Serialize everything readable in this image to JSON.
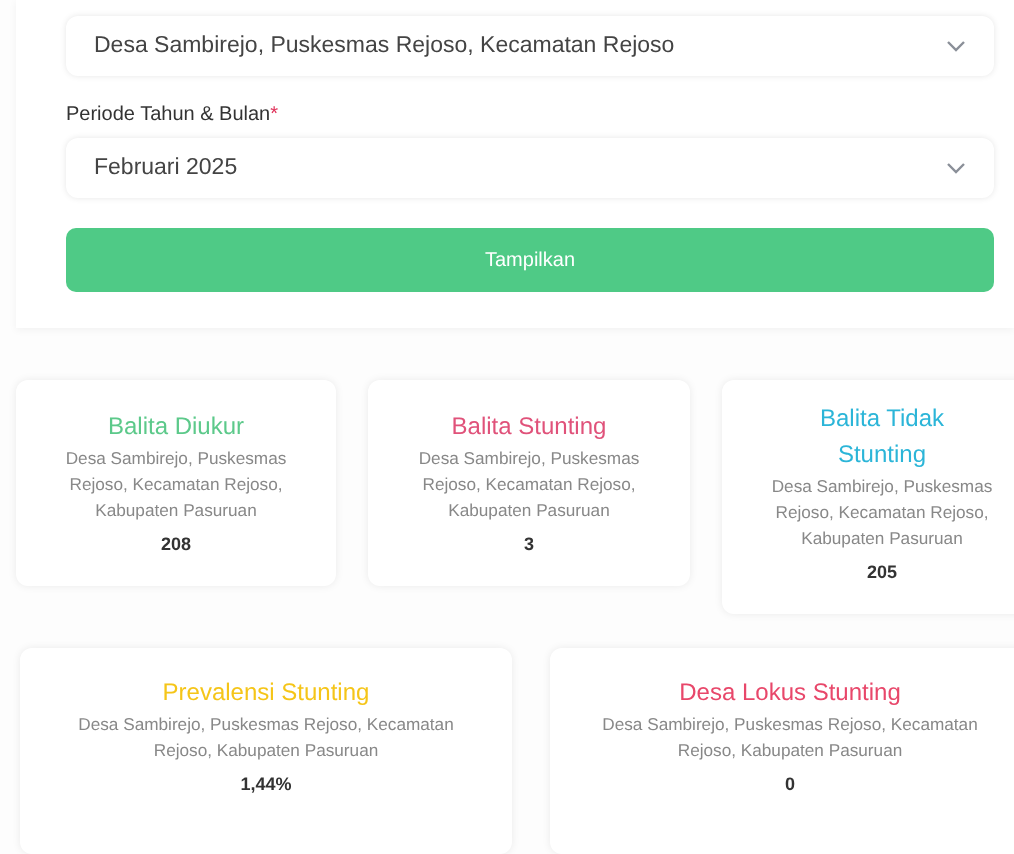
{
  "filters": [
    {
      "value": "Desa Sambirejo, Puskesmas Rejoso, Kecamatan Rejoso"
    },
    {
      "label": "Periode Tahun & Bulan",
      "required": true,
      "required_mark": "*",
      "value": "Februari 2025"
    }
  ],
  "button": "Tampilkan",
  "cards": [
    {
      "title": "Balita Diukur",
      "color": "#5cc98a",
      "location": "Desa Sambirejo, Puskesmas Rejoso, Kecamatan Rejoso, Kabupaten Pasuruan",
      "value": "208"
    },
    {
      "title": "Balita Stunting",
      "color": "#e0527a",
      "location": "Desa Sambirejo, Puskesmas Rejoso, Kecamatan Rejoso, Kabupaten Pasuruan",
      "value": "3"
    },
    {
      "title": "Balita Tidak Stunting",
      "color": "#2bb5d8",
      "location": "Desa Sambirejo, Puskesmas Rejoso, Kecamatan Rejoso, Kabupaten Pasuruan",
      "value": "205"
    },
    {
      "title": "Prevalensi Stunting",
      "color": "#f5c518",
      "location": "Desa Sambirejo, Puskesmas Rejoso, Kecamatan Rejoso, Kabupaten Pasuruan",
      "value": "1,44%"
    },
    {
      "title": "Desa Lokus Stunting",
      "color": "#e8476a",
      "location": "Desa Sambirejo, Puskesmas Rejoso, Kecamatan Rejoso, Kabupaten Pasuruan",
      "value": "0"
    }
  ]
}
